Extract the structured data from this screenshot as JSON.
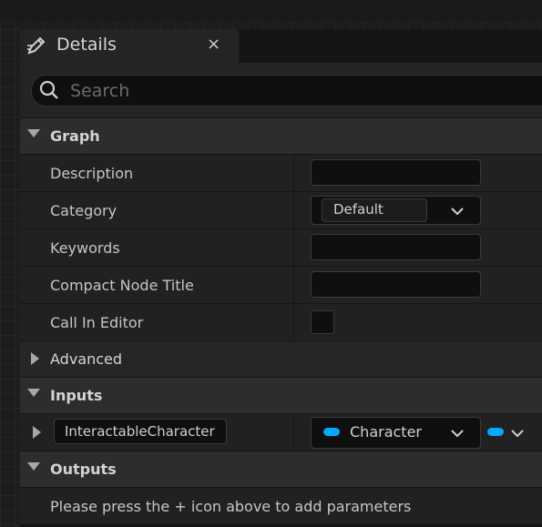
{
  "panel": {
    "tab_title": "Details",
    "close_glyph": "×",
    "tab_icon": "pencil-icon"
  },
  "search": {
    "placeholder": "Search",
    "value": ""
  },
  "sections": {
    "graph": {
      "label": "Graph",
      "properties": {
        "description": {
          "label": "Description",
          "value": ""
        },
        "category": {
          "label": "Category",
          "value": "Default"
        },
        "keywords": {
          "label": "Keywords",
          "value": ""
        },
        "compact_node_title": {
          "label": "Compact Node Title",
          "value": ""
        },
        "call_in_editor": {
          "label": "Call In Editor",
          "checked": false
        }
      }
    },
    "advanced": {
      "label": "Advanced"
    },
    "inputs": {
      "label": "Inputs",
      "parameter": {
        "name": "InteractableCharacter",
        "type": "Character",
        "pin_color": "#00a8ff"
      }
    },
    "outputs": {
      "label": "Outputs",
      "message": "Please press the + icon above to add parameters"
    }
  },
  "colors": {
    "panel_bg": "#151515",
    "header_bg": "#2d2d2d",
    "row_bg": "#212121",
    "field_bg": "#0f0f0f",
    "object_pin": "#00a8ff"
  }
}
